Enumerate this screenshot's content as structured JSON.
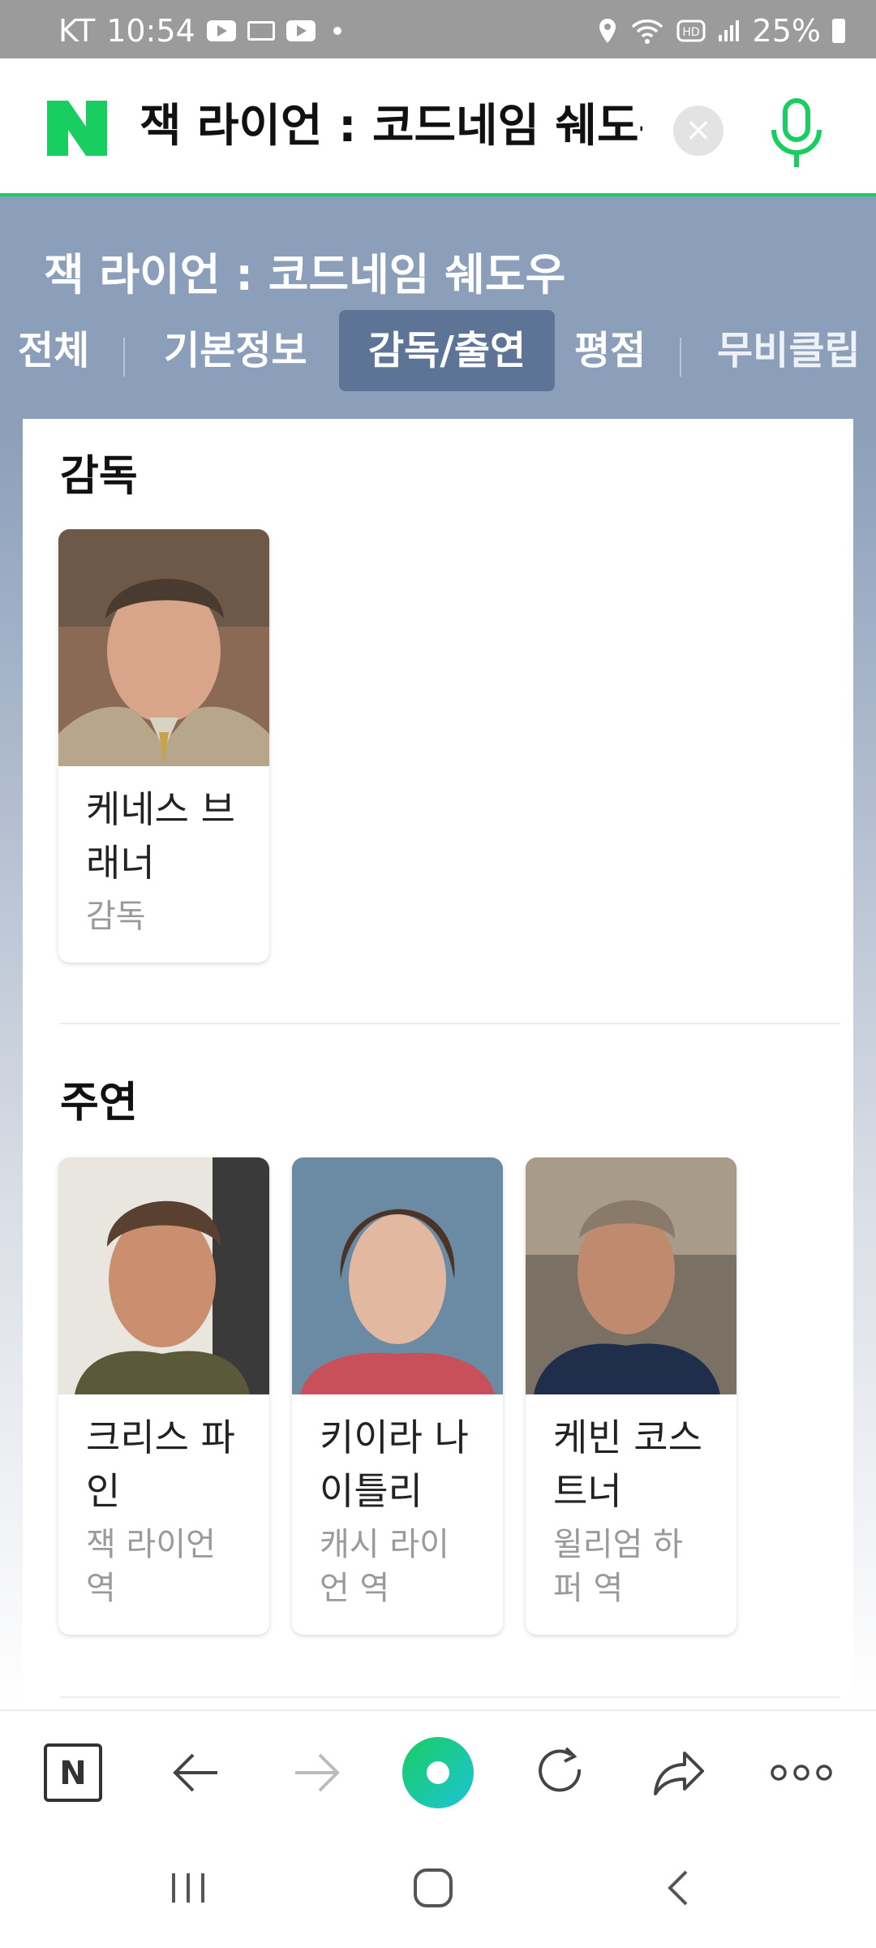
{
  "status_bar": {
    "carrier": "KT",
    "time": "10:54",
    "battery": "25%",
    "icons": [
      "youtube-icon",
      "mail-icon",
      "youtube-icon",
      "notification-dot-icon",
      "location-icon",
      "wifi-icon",
      "hd-voice-icon",
      "signal-icon",
      "battery-icon"
    ]
  },
  "search": {
    "query": "잭 라이언 : 코드네임 쉐도우",
    "logo": "N"
  },
  "movie": {
    "title": "잭 라이언 : 코드네임 쉐도우",
    "tabs": [
      "전체",
      "기본정보",
      "감독/출연",
      "평점",
      "무비클립"
    ],
    "active_tab": "감독/출연"
  },
  "directors": {
    "heading": "감독",
    "people": [
      {
        "name": "케네스 브래너",
        "name_line1": "케네스 브",
        "name_line2": "래너",
        "role": "감독"
      }
    ]
  },
  "cast": {
    "heading": "주연",
    "people": [
      {
        "name_line1": "크리스 파",
        "name_line2": "인",
        "role_line1": "잭 라이언",
        "role_line2": "역"
      },
      {
        "name_line1": "키이라 나",
        "name_line2": "이틀리",
        "role_line1": "캐시 라이",
        "role_line2": "언 역"
      },
      {
        "name_line1": "케빈 코스",
        "name_line2": "트너",
        "role_line1": "윌리엄 하",
        "role_line2": "퍼 역"
      }
    ]
  },
  "toolbar": {
    "home_label": "N",
    "icons": [
      "naver-home-icon",
      "back-arrow-icon",
      "forward-arrow-icon",
      "green-dot-icon",
      "refresh-icon",
      "share-icon",
      "more-icon"
    ]
  },
  "colors": {
    "naver_green": "#19ce60",
    "band": "#8b9fba",
    "active_tab": "#5d7496"
  }
}
